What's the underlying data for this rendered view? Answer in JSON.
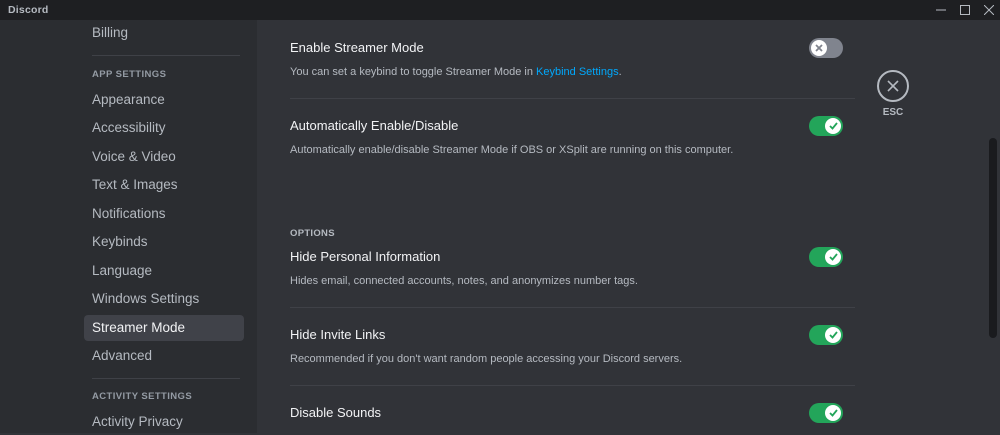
{
  "window": {
    "title": "Discord",
    "controls": [
      "minimize-icon",
      "maximize-icon",
      "close-icon"
    ]
  },
  "sidebar": {
    "top_item": "Billing",
    "app_settings_header": "APP SETTINGS",
    "items": [
      {
        "label": "Appearance"
      },
      {
        "label": "Accessibility"
      },
      {
        "label": "Voice & Video"
      },
      {
        "label": "Text & Images"
      },
      {
        "label": "Notifications"
      },
      {
        "label": "Keybinds"
      },
      {
        "label": "Language"
      },
      {
        "label": "Windows Settings"
      },
      {
        "label": "Streamer Mode",
        "selected": true
      },
      {
        "label": "Advanced"
      }
    ],
    "activity_settings_header": "ACTIVITY SETTINGS",
    "activity_items": [
      {
        "label": "Activity Privacy"
      }
    ]
  },
  "main": {
    "enable_streamer_mode": {
      "title": "Enable Streamer Mode",
      "desc_prefix": "You can set a keybind to toggle Streamer Mode in ",
      "desc_link": "Keybind Settings",
      "desc_suffix": ".",
      "enabled": false
    },
    "auto_enable": {
      "title": "Automatically Enable/Disable",
      "desc": "Automatically enable/disable Streamer Mode if OBS or XSplit are running on this computer.",
      "enabled": true
    },
    "options_header": "OPTIONS",
    "hide_personal_info": {
      "title": "Hide Personal Information",
      "desc": "Hides email, connected accounts, notes, and anonymizes number tags.",
      "enabled": true
    },
    "hide_invite_links": {
      "title": "Hide Invite Links",
      "desc": "Recommended if you don't want random people accessing your Discord servers.",
      "enabled": true
    },
    "disable_sounds": {
      "title": "Disable Sounds",
      "enabled": true
    }
  },
  "close": {
    "label": "ESC"
  },
  "colors": {
    "toggle_on": "#23a55a",
    "toggle_off": "#80848e",
    "link": "#00a8fc",
    "selected_bg": "#404249"
  }
}
